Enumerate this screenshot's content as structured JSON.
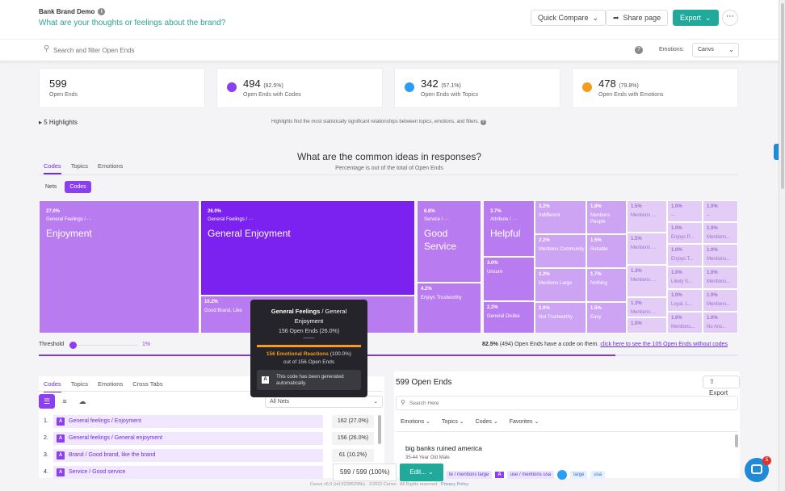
{
  "header": {
    "project": "Bank Brand Demo",
    "question": "What are your thoughts or feelings about the brand?",
    "quick_compare": "Quick Compare",
    "share": "Share page",
    "export": "Export"
  },
  "search": {
    "placeholder": "Search and filter Open Ends",
    "emotions_label": "Emotions:",
    "emotions_value": "Canvs"
  },
  "stats": [
    {
      "value": "599",
      "pct": "",
      "label": "Open Ends"
    },
    {
      "value": "494",
      "pct": "(82.5%)",
      "label": "Open Ends with Codes"
    },
    {
      "value": "342",
      "pct": "(57.1%)",
      "label": "Open Ends with Topics"
    },
    {
      "value": "478",
      "pct": "(79.8%)",
      "label": "Open Ends with Emotions"
    }
  ],
  "highlights": {
    "label": "5 Highlights",
    "note": "Highlights find the most statistically significant relationships between topics, emotions, and filters."
  },
  "section": {
    "title": "What are the common ideas in responses?",
    "subtitle": "Percentage is out of the total of Open Ends"
  },
  "top_tabs": [
    "Codes",
    "Topics",
    "Emotions"
  ],
  "pills": [
    "Nets",
    "Codes"
  ],
  "treemap": [
    {
      "pct": "27.0%",
      "parent": "General Feelings / ···",
      "name": "Enjoyment"
    },
    {
      "pct": "26.0%",
      "parent": "General Feelings / ···",
      "name": "General Enjoyment"
    },
    {
      "pct": "10.2%",
      "parent": "",
      "name": "Good Brand, Like"
    },
    {
      "pct": "6.8%",
      "parent": "Service / ···",
      "name": "Good Service"
    },
    {
      "pct": "4.2%",
      "parent": "",
      "name": "Enjoys Trustworthy"
    },
    {
      "pct": "3.7%",
      "parent": "Attribute / ···",
      "name": "Helpful"
    },
    {
      "pct": "3.0%",
      "parent": "",
      "name": "Unsure"
    },
    {
      "pct": "2.2%",
      "parent": "",
      "name": "General Dislike"
    },
    {
      "pct": "3.2%",
      "parent": "",
      "name": "Indifferent"
    },
    {
      "pct": "2.2%",
      "parent": "",
      "name": "Mentions Community"
    },
    {
      "pct": "2.2%",
      "parent": "",
      "name": "Mentions Large"
    },
    {
      "pct": "2.0%",
      "parent": "",
      "name": "Not Trustworthy"
    },
    {
      "pct": "1.8%",
      "parent": "",
      "name": "Mentions People"
    },
    {
      "pct": "1.5%",
      "parent": "",
      "name": "Reliable"
    },
    {
      "pct": "1.7%",
      "parent": "",
      "name": "Nothing"
    },
    {
      "pct": "1.5%",
      "parent": "",
      "name": "Easy"
    },
    {
      "pct": "1.5%",
      "parent": "",
      "name": "Mentions ..."
    },
    {
      "pct": "1.5%",
      "parent": "",
      "name": "Mentions ..."
    },
    {
      "pct": "1.3%",
      "parent": "",
      "name": "Mentions ..."
    },
    {
      "pct": "1.3%",
      "parent": "",
      "name": "Mentions ..."
    },
    {
      "pct": "1.0%",
      "parent": "",
      "name": ""
    },
    {
      "pct": "1.0%",
      "parent": "",
      "name": "--"
    },
    {
      "pct": "1.0%",
      "parent": "",
      "name": "Enjoys P..."
    },
    {
      "pct": "1.0%",
      "parent": "",
      "name": "Enjoys T..."
    },
    {
      "pct": "1.0%",
      "parent": "",
      "name": "Likely S..."
    },
    {
      "pct": "1.0%",
      "parent": "",
      "name": "Loyal, L..."
    },
    {
      "pct": "1.0%",
      "parent": "",
      "name": "Mentions..."
    },
    {
      "pct": "1.0%",
      "parent": "",
      "name": "--"
    },
    {
      "pct": "1.0%",
      "parent": "",
      "name": "Mentions..."
    },
    {
      "pct": "1.0%",
      "parent": "",
      "name": "Mentions..."
    },
    {
      "pct": "1.0%",
      "parent": "",
      "name": "Mentions..."
    },
    {
      "pct": "1.0%",
      "parent": "",
      "name": "Mentions..."
    },
    {
      "pct": "1.0%",
      "parent": "",
      "name": "No Ans..."
    }
  ],
  "threshold": {
    "label": "Threshold",
    "value": "1%",
    "coverage_pct": "82.5%",
    "coverage_text": "(494) Open Ends have a code on them.",
    "coverage_link": "click here to see the 105 Open Ends without codes",
    "fill_fraction": 0.825
  },
  "tooltip": {
    "title_bold": "General Feelings",
    "title_rest": " / General Enjoyment",
    "count": "156 Open Ends (26.0%)",
    "dash": "——",
    "emotional": "156 Emotional Reactions",
    "emotional_pct": "(100.0%)",
    "out_of": "out of 156 Open Ends",
    "note": "This code has been generated automatically."
  },
  "lower_tabs": [
    "Codes",
    "Topics",
    "Emotions",
    "Cross Tabs"
  ],
  "nets_select": "All Nets",
  "code_rows": [
    {
      "idx": "1.",
      "name": "General feelings / Enjoyment",
      "count": "162 (27.0%)"
    },
    {
      "idx": "2.",
      "name": "General feelings / General enjoyment",
      "count": "156 (26.0%)"
    },
    {
      "idx": "3.",
      "name": "Brand / Good brand, like the brand",
      "count": "61 (10.2%)"
    },
    {
      "idx": "4.",
      "name": "Service / Good service",
      "count": ""
    }
  ],
  "open_ends": {
    "title": "599 Open Ends",
    "export": "Export",
    "search_placeholder": "Search Here",
    "filters": [
      "Emotions",
      "Topics",
      "Codes",
      "Favorites"
    ],
    "response_text": "big banks ruined america",
    "response_meta": "35-44 Year Old Male"
  },
  "bottom_bar": {
    "count": "599 / 599 (100%)",
    "edit": "Edit..."
  },
  "tags": {
    "t1": "te / mentions large",
    "t2": "use / mentions usa",
    "t3": "large",
    "t4": "usa"
  },
  "footer": {
    "text": "Canvs v5.0 (ref.92385295b) · ©2022 Canvs · All Rights reserved ·",
    "link": "Privacy Policy"
  },
  "chat_badge": "5",
  "colors": {
    "purple_dark": "#7b22f0",
    "purple_mid": "#b97cf0",
    "purple_light": "#cda4f4",
    "purple_pale": "#e3cdf7",
    "teal": "#21a99b",
    "orange": "#f39c1f"
  }
}
